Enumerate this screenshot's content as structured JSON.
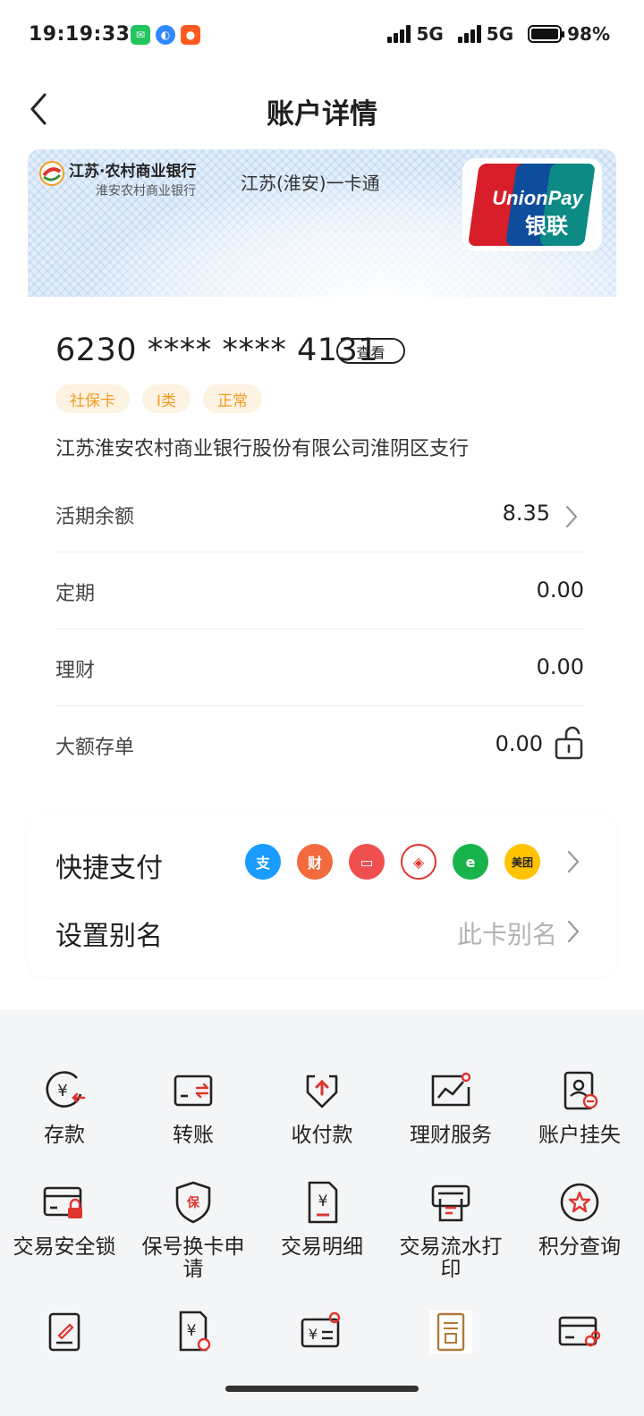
{
  "status_bar": {
    "time": "19:19:33",
    "network_1": "5G",
    "network_2": "5G",
    "battery": "98%",
    "battery_level": 0.98
  },
  "header": {
    "title": "账户详情"
  },
  "card": {
    "bank_name": "江苏·农村商业银行",
    "bank_sub": "淮安农村商业银行",
    "product_name": "江苏(淮安)一卡通",
    "network_logo_line1": "UnionPay",
    "network_logo_line2": "银联",
    "number_masked": "6230 **** **** 4131",
    "view_button": "查看",
    "tags": [
      "社保卡",
      "I类",
      "正常"
    ],
    "branch": "江苏淮安农村商业银行股份有限公司淮阴区支行"
  },
  "balances": [
    {
      "label": "活期余额",
      "value": "8.35"
    },
    {
      "label": "定期",
      "value": "0.00"
    },
    {
      "label": "理财",
      "value": "0.00"
    },
    {
      "label": "大额存单",
      "value": "0.00"
    }
  ],
  "quick_pay": {
    "label": "快捷支付",
    "icons": [
      {
        "glyph": "支",
        "color": "#1a9bff"
      },
      {
        "glyph": "财",
        "color": "#f26a3d"
      },
      {
        "glyph": "▭",
        "color": "#f04f4f"
      },
      {
        "glyph": "◈",
        "color": "#ffffff"
      },
      {
        "glyph": "e",
        "color": "#18b34a"
      },
      {
        "glyph": "美团",
        "color": "#ffc300"
      }
    ]
  },
  "alias": {
    "label": "设置别名",
    "placeholder": "此卡别名"
  },
  "services": [
    {
      "label": "存款",
      "icon": "deposit-icon"
    },
    {
      "label": "转账",
      "icon": "transfer-icon"
    },
    {
      "label": "收付款",
      "icon": "receive-pay-icon"
    },
    {
      "label": "理财服务",
      "icon": "wealth-chart-icon"
    },
    {
      "label": "账户挂失",
      "icon": "report-loss-icon"
    },
    {
      "label": "交易安全锁",
      "icon": "card-lock-icon"
    },
    {
      "label": "保号换卡申请",
      "icon": "shield-card-icon"
    },
    {
      "label": "交易明细",
      "icon": "transaction-detail-icon"
    },
    {
      "label": "交易流水打印",
      "icon": "printer-icon"
    },
    {
      "label": "积分查询",
      "icon": "points-star-icon"
    }
  ],
  "colors": {
    "accent_red": "#e0342e",
    "tag_orange": "#f39a1e"
  }
}
